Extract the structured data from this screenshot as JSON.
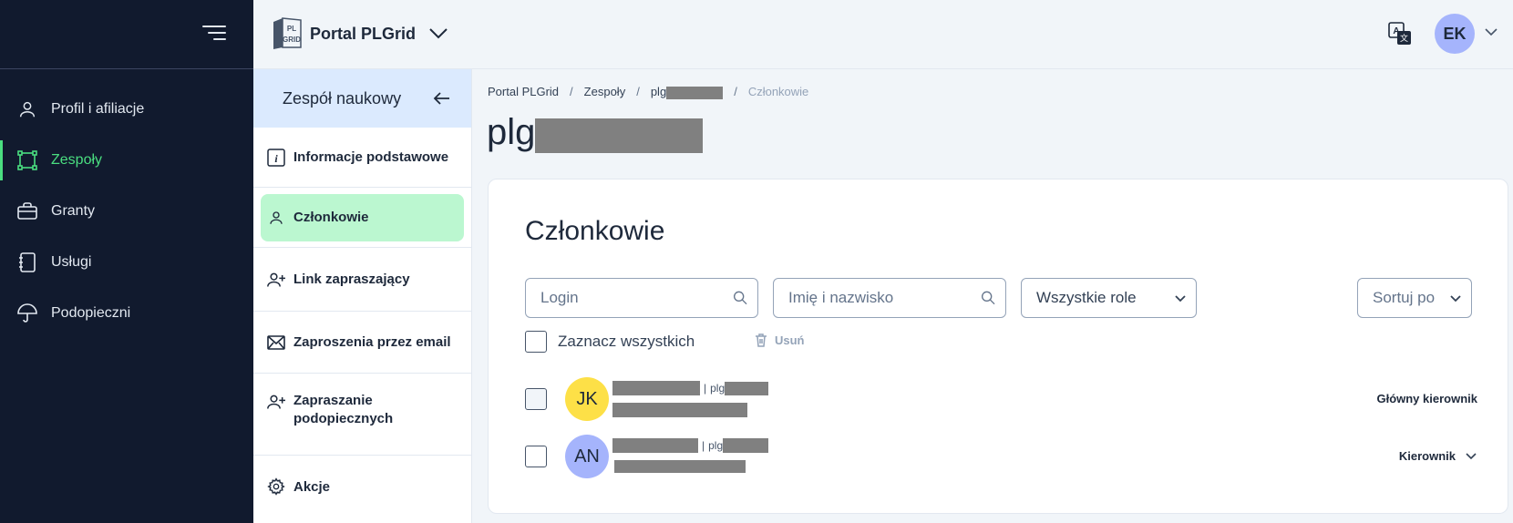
{
  "sidebar": {
    "items": [
      {
        "label": "Profil i afiliacje",
        "icon": "user-icon"
      },
      {
        "label": "Zespoły",
        "icon": "team-icon",
        "active": true
      },
      {
        "label": "Granty",
        "icon": "briefcase-icon"
      },
      {
        "label": "Usługi",
        "icon": "notebook-icon"
      },
      {
        "label": "Podopieczni",
        "icon": "umbrella-icon"
      }
    ]
  },
  "header": {
    "brand": "Portal PLGrid",
    "logo_text": "PL GRID",
    "user_initials": "EK"
  },
  "subnav": {
    "title": "Zespół naukowy",
    "items": [
      {
        "label": "Informacje podstawowe",
        "icon": "info-icon"
      },
      {
        "label": "Członkowie",
        "icon": "user-icon",
        "active": true
      },
      {
        "label": "Link zapraszający",
        "icon": "user-plus-icon"
      },
      {
        "label": "Zaproszenia przez email",
        "icon": "envelope-icon"
      },
      {
        "label": "Zapraszanie podopiecznych",
        "icon": "user-plus-icon"
      },
      {
        "label": "Akcje",
        "icon": "gear-icon"
      }
    ]
  },
  "breadcrumb": {
    "items": [
      "Portal PLGrid",
      "Zespoły",
      "plg",
      "Członkowie"
    ]
  },
  "page": {
    "title": "plg"
  },
  "members_card": {
    "title": "Członkowie",
    "login_placeholder": "Login",
    "name_placeholder": "Imię i nazwisko",
    "role_filter": "Wszystkie role",
    "sort_label": "Sortuj po",
    "select_all": "Zaznacz wszystkich",
    "delete_label": "Usuń",
    "members": [
      {
        "initials": "JK",
        "login_prefix": "plg",
        "role": "Główny kierownik",
        "avatar_color": "#fde047"
      },
      {
        "initials": "AN",
        "login_prefix": "plg",
        "role": "Kierownik",
        "avatar_color": "#a5b4fc"
      }
    ]
  },
  "colors": {
    "sidebar_bg": "#111a2e",
    "accent_green": "#4ade80",
    "active_pill": "#bbf7d0",
    "subnav_head": "#dbeafe"
  }
}
